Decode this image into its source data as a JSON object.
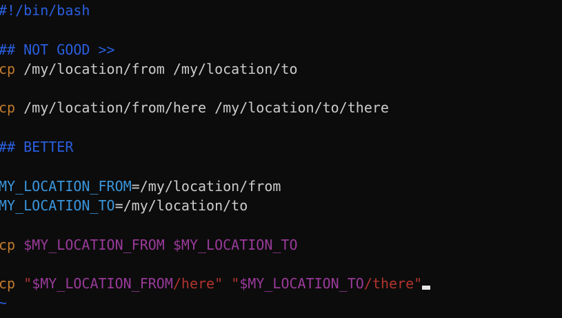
{
  "editor": {
    "lines": [
      {
        "tokens": [
          {
            "t": "#!/bin/bash",
            "k": "shebang"
          }
        ]
      },
      {
        "tokens": []
      },
      {
        "tokens": [
          {
            "t": "## NOT GOOD >>",
            "k": "comment"
          }
        ]
      },
      {
        "tokens": [
          {
            "t": "cp",
            "k": "cmd"
          },
          {
            "t": " /my/location/from /my/location/to",
            "k": "plain"
          }
        ]
      },
      {
        "tokens": []
      },
      {
        "tokens": [
          {
            "t": "cp",
            "k": "cmd"
          },
          {
            "t": " /my/location/from/here /my/location/to/there",
            "k": "plain"
          }
        ]
      },
      {
        "tokens": []
      },
      {
        "tokens": [
          {
            "t": "## BETTER",
            "k": "comment"
          }
        ]
      },
      {
        "tokens": []
      },
      {
        "tokens": [
          {
            "t": "MY_LOCATION_FROM",
            "k": "var"
          },
          {
            "t": "=/my/location/from",
            "k": "plain"
          }
        ]
      },
      {
        "tokens": [
          {
            "t": "MY_LOCATION_TO",
            "k": "var"
          },
          {
            "t": "=/my/location/to",
            "k": "plain"
          }
        ]
      },
      {
        "tokens": []
      },
      {
        "tokens": [
          {
            "t": "cp",
            "k": "cmd"
          },
          {
            "t": " ",
            "k": "plain"
          },
          {
            "t": "$MY_LOCATION_FROM",
            "k": "ref"
          },
          {
            "t": " ",
            "k": "plain"
          },
          {
            "t": "$MY_LOCATION_TO",
            "k": "ref"
          }
        ]
      },
      {
        "tokens": []
      },
      {
        "tokens": [
          {
            "t": "cp",
            "k": "cmd"
          },
          {
            "t": " ",
            "k": "plain"
          },
          {
            "t": "\"",
            "k": "str"
          },
          {
            "t": "$MY_LOCATION_FROM",
            "k": "ref"
          },
          {
            "t": "/here\"",
            "k": "str"
          },
          {
            "t": " ",
            "k": "plain"
          },
          {
            "t": "\"",
            "k": "str"
          },
          {
            "t": "$MY_LOCATION_TO",
            "k": "ref"
          },
          {
            "t": "/there\"",
            "k": "str"
          }
        ],
        "cursor": true
      },
      {
        "tokens": [
          {
            "t": "~",
            "k": "tilde"
          }
        ]
      }
    ]
  }
}
